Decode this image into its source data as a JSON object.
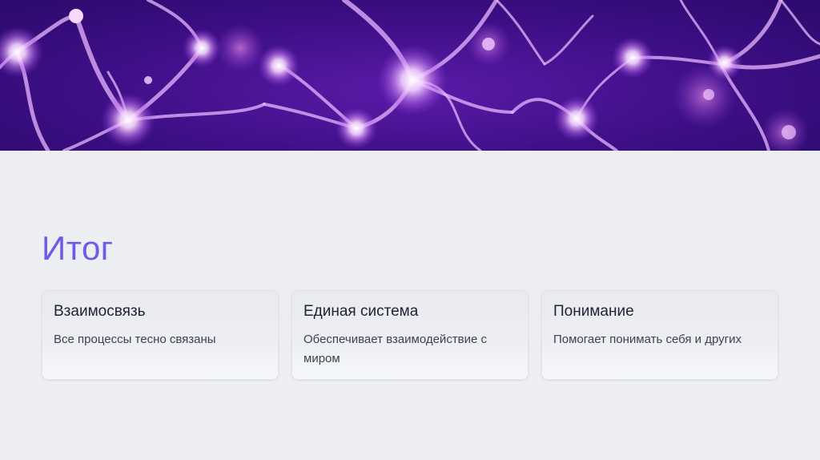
{
  "slide": {
    "title": "Итог"
  },
  "cards": [
    {
      "title": "Взаимосвязь",
      "text": "Все процессы тесно связаны"
    },
    {
      "title": "Единая система",
      "text": "Обеспечивает взаимодействие с миром"
    },
    {
      "title": "Понимание",
      "text": "Помогает понимать себя и других"
    }
  ],
  "colors": {
    "accent": "#6b5ce7",
    "background": "#eceef2",
    "hero": "#3d0f86"
  }
}
